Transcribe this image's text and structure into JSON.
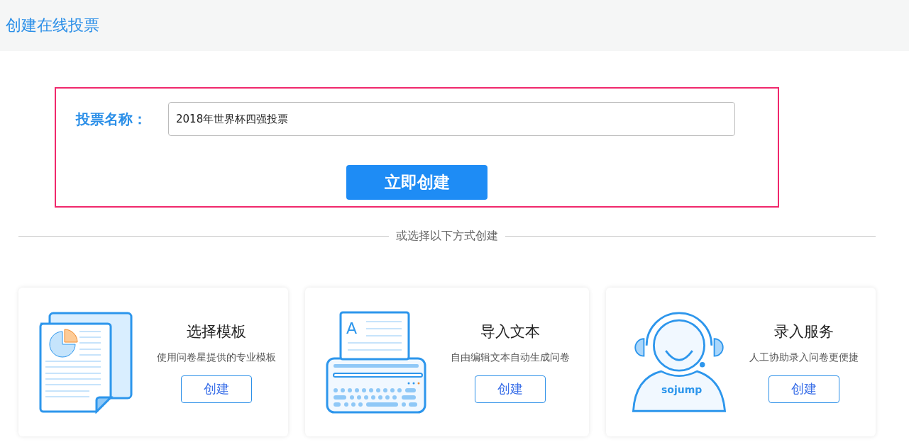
{
  "header": {
    "title": "创建在线投票"
  },
  "form": {
    "label": "投票名称：",
    "name_value": "2018年世界杯四强投票",
    "submit": "立即创建"
  },
  "divider_text": "或选择以下方式创建",
  "cards": [
    {
      "kind": "template",
      "title": "选择模板",
      "description": "使用问卷星提供的专业模板",
      "button": "创建"
    },
    {
      "kind": "import",
      "paper_glyph": "A",
      "title": "导入文本",
      "description": "自由编辑文本自动生成问卷",
      "button": "创建"
    },
    {
      "kind": "service",
      "title": "录入服务",
      "description": "人工协助录入问卷更便捷",
      "button": "创建",
      "badge": "sojump"
    }
  ]
}
